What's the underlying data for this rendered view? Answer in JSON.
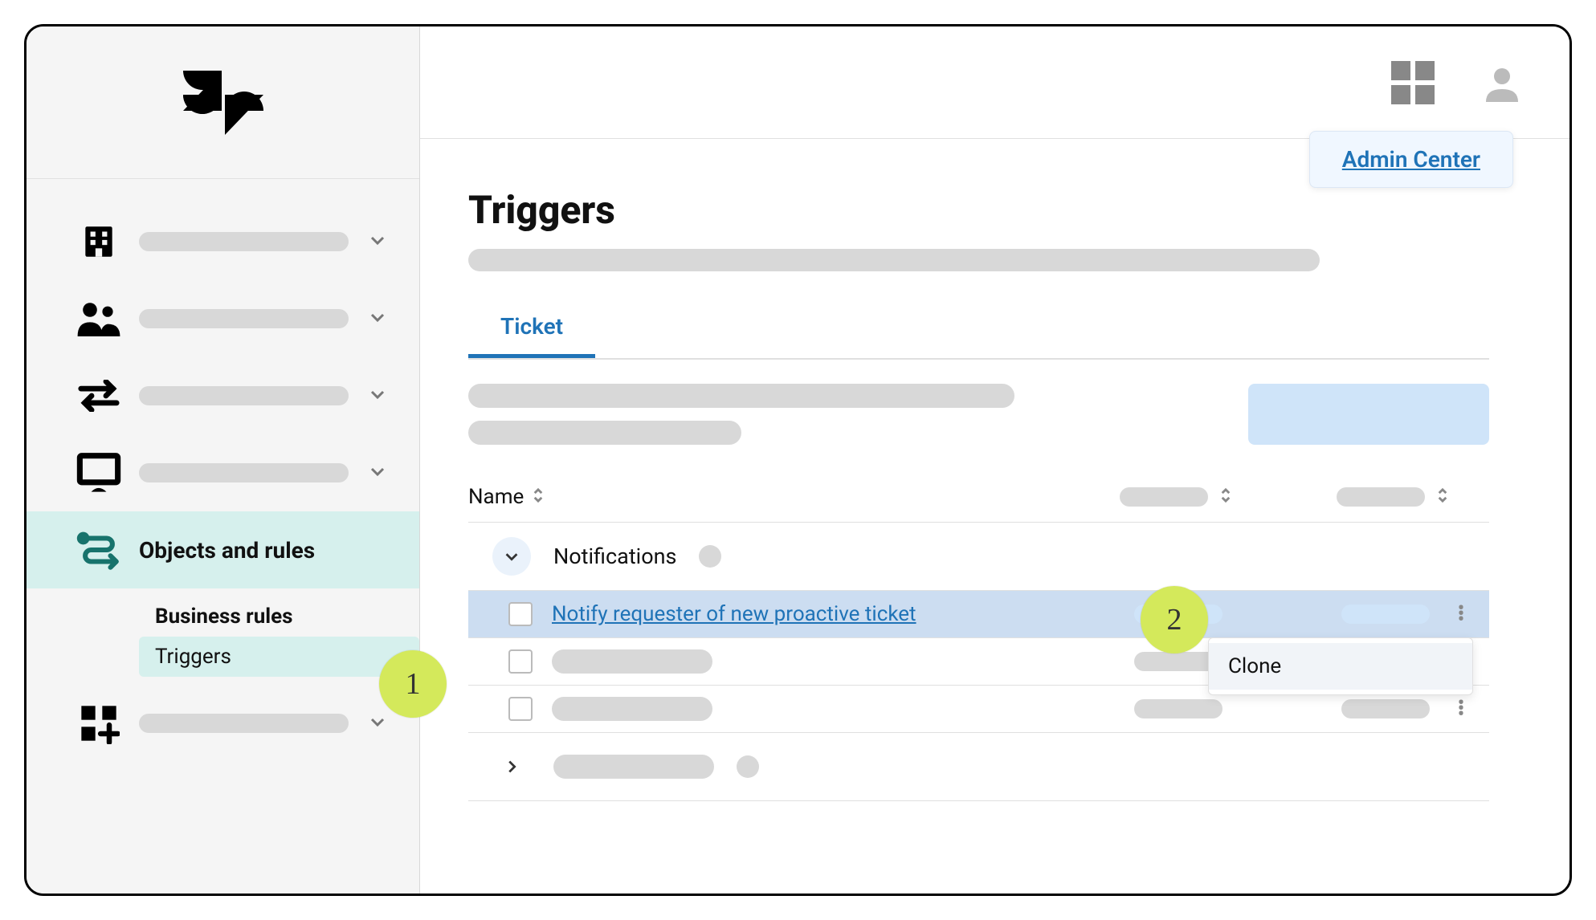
{
  "header": {
    "context_link": "Admin Center"
  },
  "sidebar": {
    "active_label": "Objects and rules",
    "sub_heading": "Business rules",
    "sub_selected": "Triggers"
  },
  "page": {
    "title": "Triggers",
    "tab": "Ticket"
  },
  "table": {
    "col_name": "Name",
    "group_expanded": "Notifications",
    "row_link": "Notify requester of new proactive ticket",
    "menu_item": "Clone"
  },
  "annotations": {
    "badge1": "1",
    "badge2": "2"
  }
}
